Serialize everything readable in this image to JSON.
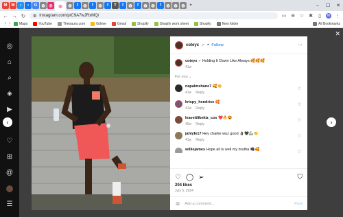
{
  "browser": {
    "url": "instagram.com/p/C9A7wJRxMQ/",
    "bookmarks": [
      "Maps",
      "YouTube",
      "Theoauro.com",
      "Gdrive",
      "Gmail",
      "Shopify",
      "Shopify work sheet",
      "Shopify",
      "New folder"
    ],
    "all_bookmarks": "All Bookmarks"
  },
  "post": {
    "username": "coteyx",
    "follow_label": "Follow",
    "caption": "Holding It Down Like Always 🥰🥰🥰",
    "caption_time": "41w",
    "for_you": "For you ⌄",
    "likes": "204 likes",
    "date": "July 5, 2024",
    "add_comment_placeholder": "Add a comment...",
    "post_label": "Post"
  },
  "comments": [
    {
      "user": "napalmshane7",
      "text": "🥰👏",
      "time": "41w",
      "reply": "Reply",
      "pfp_color": "#2a2a2a"
    },
    {
      "user": "krispy_hendrixx",
      "text": "🥰",
      "time": "41w",
      "reply": "Reply",
      "pfp_color": "#6e5a7a"
    },
    {
      "user": "leaveitlikeitiz_cox",
      "text": "❤️🔥😍",
      "time": "40w",
      "reply": "Reply",
      "pfp_color": "#7a4a3a"
    },
    {
      "user": "jahlyfe17",
      "text": "Hey charlie wuz good 👌🏿🖤🦾👏",
      "time": "41w",
      "reply": "Reply",
      "pfp_color": "#8a7a5a"
    },
    {
      "user": "williejames",
      "text": "Hope all is well my brutha 👊🏿🥰",
      "time": "",
      "reply": "",
      "pfp_color": "#9a9a9a"
    }
  ]
}
